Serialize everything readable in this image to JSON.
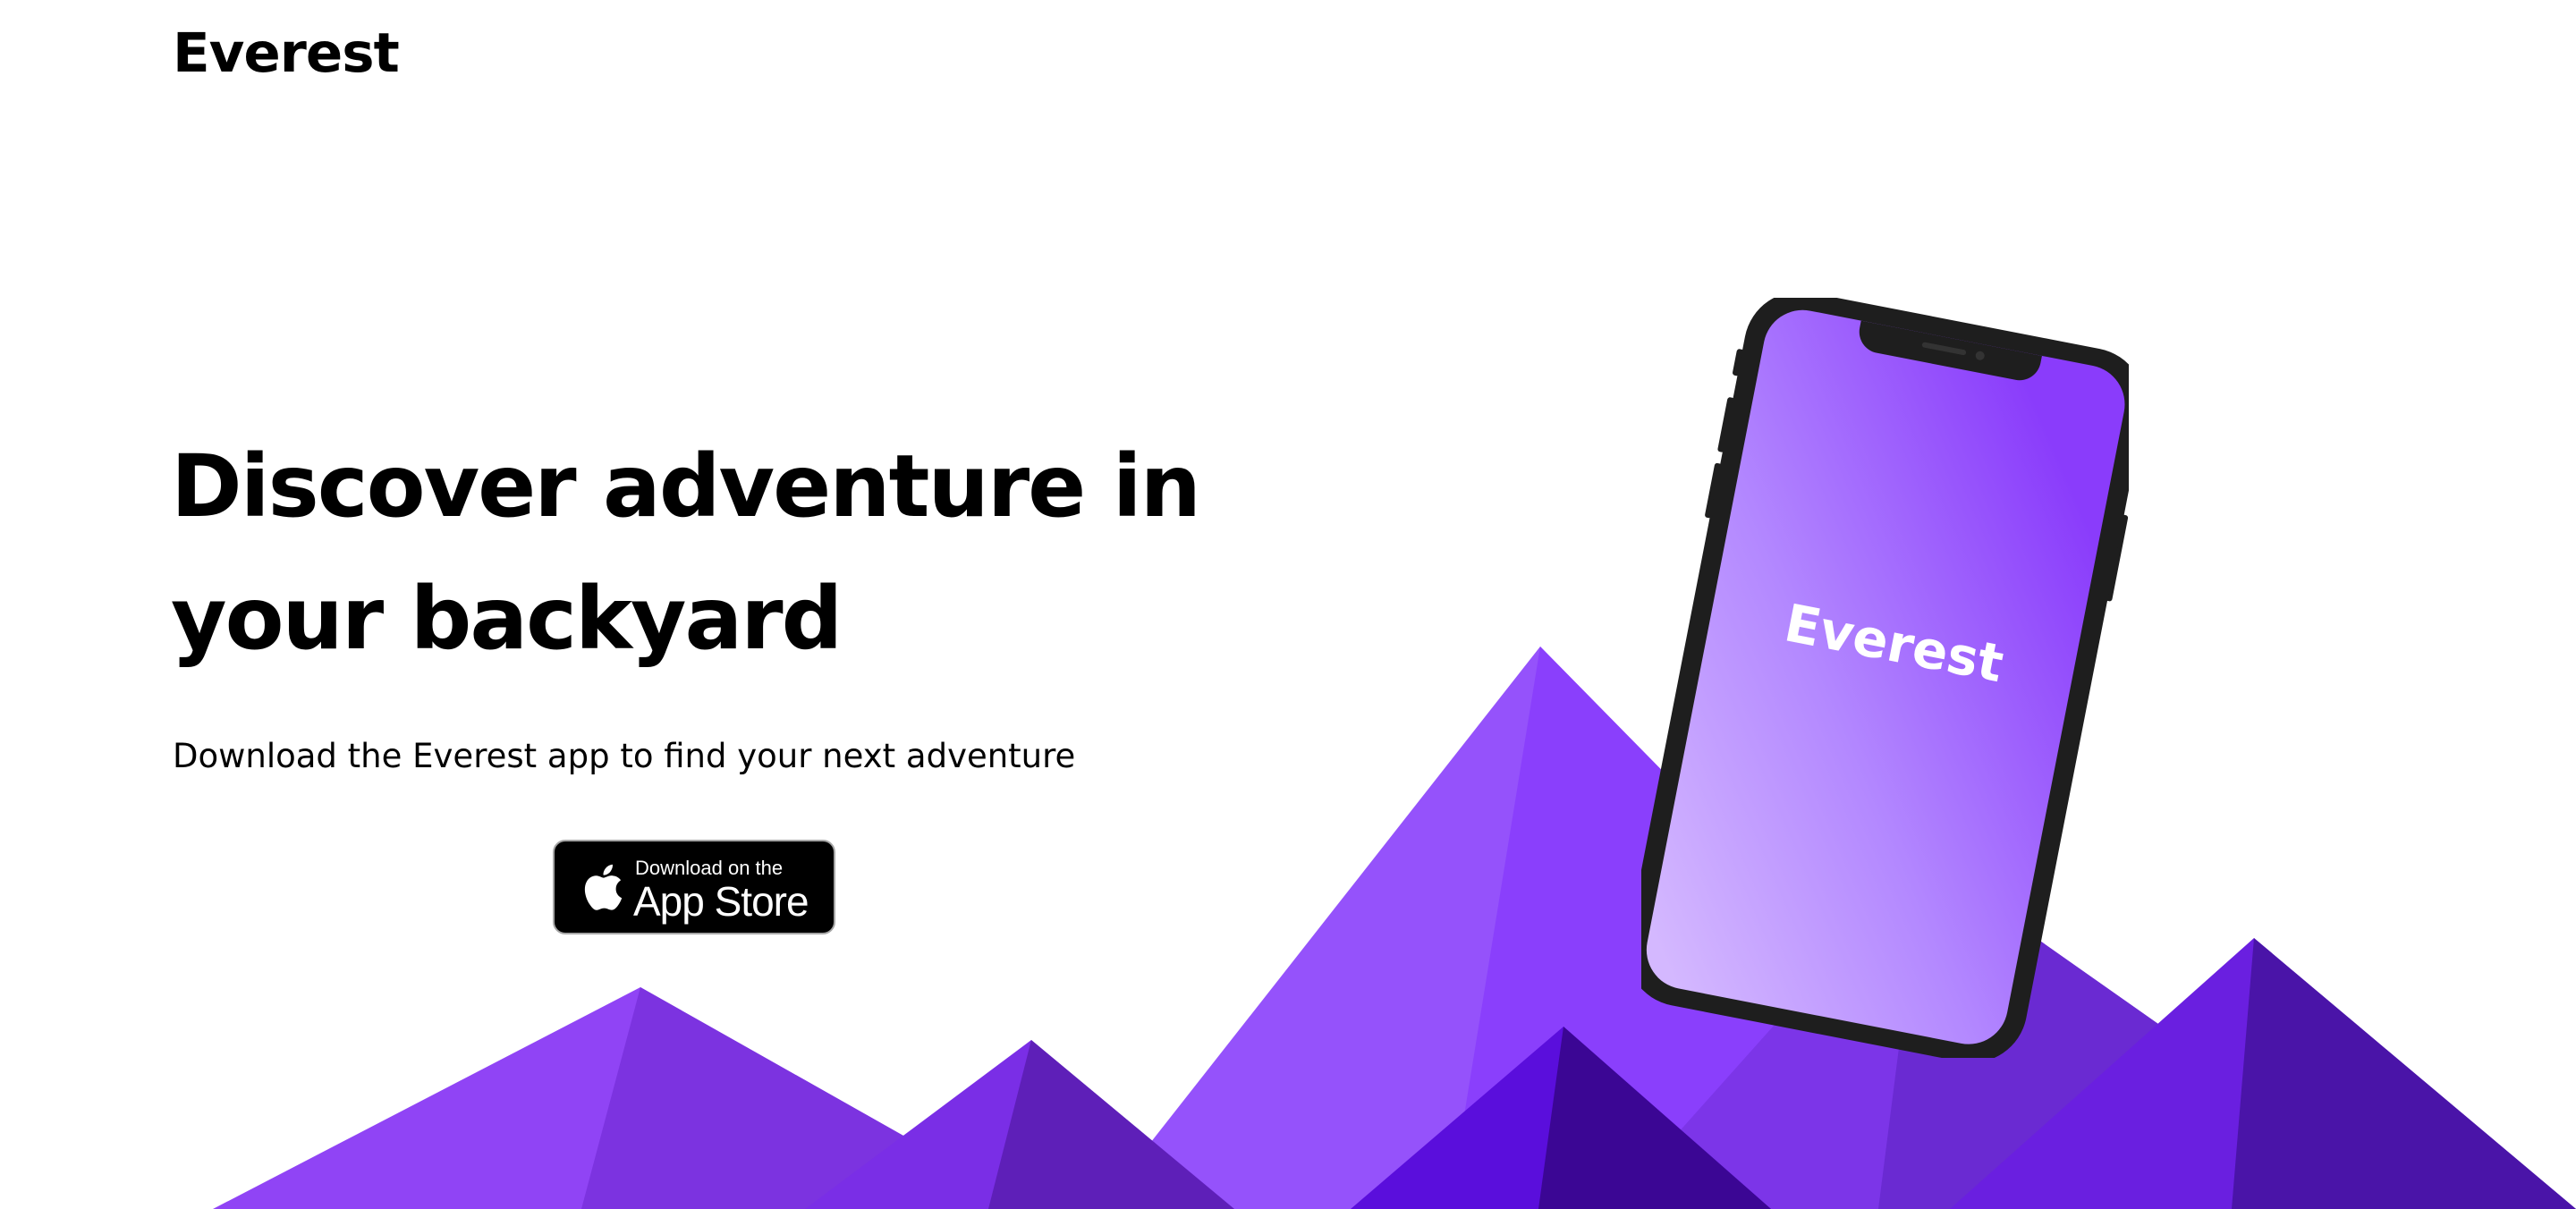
{
  "brand": {
    "logo_text": "Everest"
  },
  "hero": {
    "title_line1": "Discover adventure in",
    "title_line2": "your backyard",
    "subtitle": "Download the Everest app to find your next adventure"
  },
  "app_store_badge": {
    "small_text": "Download on the",
    "large_text": "App Store",
    "icon": "apple-icon"
  },
  "phone": {
    "screen_text": "Everest"
  },
  "colors": {
    "accent_purple": "#8a3ffc",
    "light_purple": "#a06aff",
    "mid_purple": "#7a3be0",
    "dark_purple": "#5a1fc4",
    "deep_purple": "#4a0fb8",
    "phone_frame": "#1e1e1e"
  }
}
